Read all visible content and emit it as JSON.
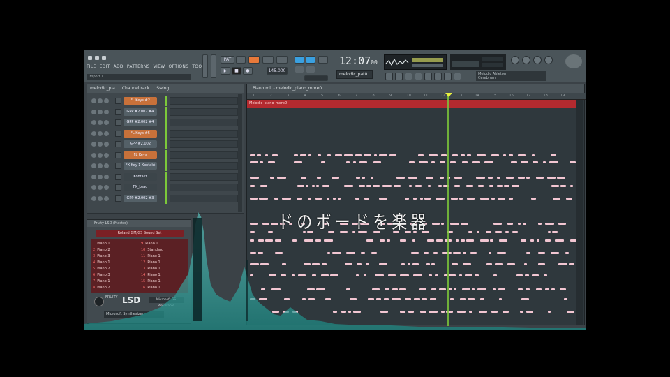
{
  "menu": [
    "FILE",
    "EDIT",
    "ADD",
    "PATTERNS",
    "VIEW",
    "OPTIONS",
    "TOOLS",
    "?"
  ],
  "hint": "Import 1",
  "transport": {
    "bpm": "145.000"
  },
  "time": {
    "main": "12:07",
    "sub": "00"
  },
  "pattern": "melodic_pat0",
  "hint_panel": {
    "line1": "Melodic Ableton",
    "line2": "Cerebrum"
  },
  "rack": {
    "title": "Channel rack",
    "filter": "melodic_pia",
    "view": "Swing",
    "channels": [
      {
        "name": "FL Keys #2",
        "style": "orange"
      },
      {
        "name": "GPP #2.002 #4",
        "style": "blue"
      },
      {
        "name": "GPP #2.002 #4",
        "style": "blue"
      },
      {
        "name": "FL Keys #5",
        "style": "orange"
      },
      {
        "name": "GPP #2.002",
        "style": "blue"
      },
      {
        "name": "FL Keys",
        "style": "orange"
      },
      {
        "name": "FX Key 1 Kontakt",
        "style": "blue"
      },
      {
        "name": "Kontakt",
        "style": "dark"
      },
      {
        "name": "FX_Lead",
        "style": "dark"
      },
      {
        "name": "GPP #2.002 #3",
        "style": "blue"
      }
    ]
  },
  "roll": {
    "title": "Piano roll - melodic_piano_more0",
    "clip_label": "Melodic_piano_more0",
    "ruler": [
      "1",
      "2",
      "3",
      "4",
      "5",
      "6",
      "7",
      "8",
      "9",
      "10",
      "11",
      "12",
      "13",
      "14",
      "15",
      "16",
      "17",
      "18",
      "19"
    ]
  },
  "lyric": "ドのボードを楽器",
  "plugin": {
    "title": "Fruity LSD (Master)",
    "preset": "Roland GM/GS Sound Set",
    "patches_left": [
      {
        "n": "1",
        "name": "Piano 1"
      },
      {
        "n": "2",
        "name": "Piano 2"
      },
      {
        "n": "3",
        "name": "Piano 3"
      },
      {
        "n": "4",
        "name": "Piano 1"
      },
      {
        "n": "5",
        "name": "Piano 2"
      },
      {
        "n": "6",
        "name": "Piano 3"
      },
      {
        "n": "7",
        "name": "Piano 1"
      },
      {
        "n": "8",
        "name": "Piano 2"
      }
    ],
    "patches_right": [
      {
        "n": "9",
        "name": "Piano 1"
      },
      {
        "n": "10",
        "name": "Standard"
      },
      {
        "n": "11",
        "name": "Piano 1"
      },
      {
        "n": "12",
        "name": "Piano 1"
      },
      {
        "n": "13",
        "name": "Piano 1"
      },
      {
        "n": "14",
        "name": "Piano 1"
      },
      {
        "n": "15",
        "name": "Piano 1"
      },
      {
        "n": "16",
        "name": "Piano 1"
      }
    ],
    "brand": "FRUITY",
    "name": "LSD",
    "button": "Microsoft GS Wavetable",
    "midi_out": "Microsoft Synthesizer"
  },
  "colors": {
    "clip": "#b32a2f",
    "note": "#f2c6d2",
    "playhead": "#7bc63a",
    "orange_channel": "#c8713a",
    "viz": "#2fd0c4"
  }
}
